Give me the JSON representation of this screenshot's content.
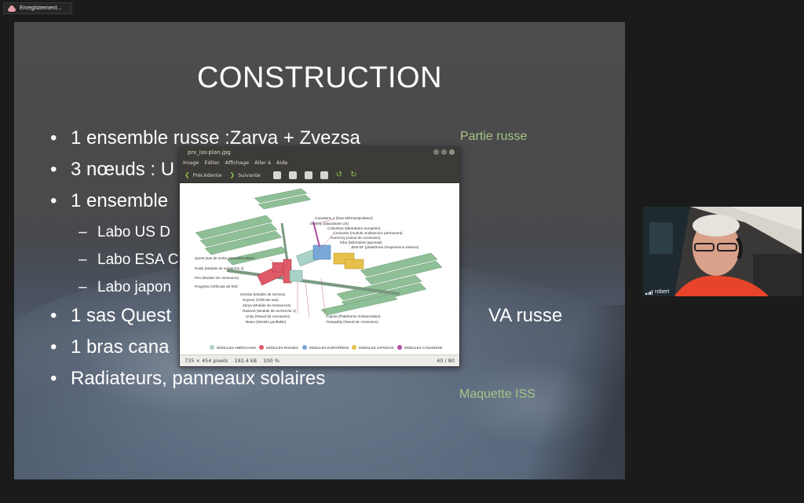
{
  "recording": {
    "label": "Enregistrement..."
  },
  "slide": {
    "title": "CONSTRUCTION",
    "bullets": [
      "1 ensemble russe :Zarva + Zvezsa",
      "3 nœuds : U",
      "1 ensemble",
      "1 sas Quest",
      "1 bras cana",
      "Radiateurs, panneaux solaires"
    ],
    "sub_bullets": [
      "Labo US D",
      "Labo ESA C",
      "Labo japon"
    ],
    "bullet4_tail": "VA russe",
    "side_notes": {
      "partie_russe": "Partie russe",
      "maquette": "Maquette ISS"
    }
  },
  "viewer": {
    "title": "prx_iss-plan.jpg",
    "menu": [
      "Image",
      "Editer",
      "Affichage",
      "Aller à",
      "Aide"
    ],
    "prev_label": "Précédente",
    "next_label": "Suivante",
    "status": {
      "dimensions": "735 × 454 pixels",
      "size": "192,4 kB",
      "zoom": "100 %",
      "position": "40 / 80"
    },
    "diagram_labels": {
      "canadarm": "Canadarm 2 (bras télémanipulateur)",
      "destiny": "Destiny (laboratoire US)",
      "columbus": "Columbus (laboratoire européen)",
      "leonardo": "Leonardo (module multiservice permanent)",
      "harmony": "Harmony (nœud de connexion)",
      "kibo": "Kibo (laboratoire japonais)",
      "jemef": "JEM-EF (plateforme d'expérience externe)",
      "quest": "Quest (sas de sortie extravéhiculaire)",
      "poisk": "Poisk (Module de recherche 2)",
      "pirs": "Pirs (Module de connexion)",
      "progress": "Progress (Véhicule de fret)",
      "zvezda": "Zvezda (Module de Service)",
      "soyouz": "Soyouz (Véhicule taxi)",
      "zarya": "Zarya (Module de ressources)",
      "rassvet": "Rassvet (Module de recherche 1)",
      "unity": "Unity (Nœud de connexion)",
      "beam": "Beam (Module gonflable)",
      "cupola": "Cupola (Plateforme d'observation)",
      "tranquility": "Tranquility (Nœud de connexion)"
    },
    "legend": [
      {
        "label": "MODULES AMÉRICAINS",
        "color": "#a9d3c8"
      },
      {
        "label": "MODULES RUSSES",
        "color": "#e05a6a"
      },
      {
        "label": "MODULES EUROPÉENS",
        "color": "#79a8d8"
      },
      {
        "label": "MODULES JAPONAIS",
        "color": "#e6c04a"
      },
      {
        "label": "MODULES CANADIENS",
        "color": "#b04aa0"
      }
    ]
  },
  "webcam": {
    "participant_name": "robert"
  }
}
